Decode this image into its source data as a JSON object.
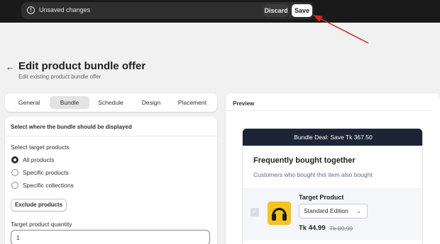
{
  "save_bar": {
    "message": "Unsaved changes",
    "discard_label": "Discard",
    "save_label": "Save"
  },
  "header": {
    "back_glyph": "←",
    "title": "Edit product bundle offer",
    "subtitle": "Edit existing product bundle offer"
  },
  "tabs": [
    {
      "label": "General",
      "active": false
    },
    {
      "label": "Bundle",
      "active": true
    },
    {
      "label": "Schedule",
      "active": false
    },
    {
      "label": "Design",
      "active": false
    },
    {
      "label": "Placement",
      "active": false
    }
  ],
  "settings": {
    "section_title": "Select where the bundle should be displayed",
    "target_label": "Select target products",
    "options": [
      {
        "label": "All products",
        "selected": true
      },
      {
        "label": "Specific products",
        "selected": false
      },
      {
        "label": "Specific collections",
        "selected": false
      }
    ],
    "exclude_button": "Exclude products",
    "quantity_label": "Target product quantity",
    "quantity_value": "1"
  },
  "preview": {
    "heading": "Preview",
    "deal_banner": "Bundle Deal: Save Tk 367.50",
    "title": "Frequently bought together",
    "subtitle": "Customers who bought this item also bought",
    "product": {
      "name": "Target Product",
      "variant": "Standard Edition",
      "price": "Tk 44.99",
      "compare_price": "Tk 89.99"
    }
  },
  "colors": {
    "topbar": "#1a1a1a",
    "banner": "#1c2536",
    "arrow": "#d9251c",
    "thumb": "#f4c31d"
  },
  "icons": {
    "warning": "info-circle-icon",
    "back": "arrow-left-icon",
    "variant": "chevron-down-icon",
    "product": "headphones-icon"
  }
}
